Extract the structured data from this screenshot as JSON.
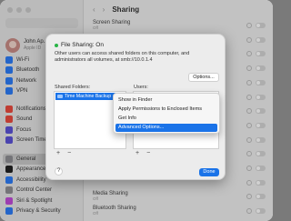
{
  "window_title": "Sharing",
  "user": {
    "name": "John Ap...",
    "sub": "Apple ID"
  },
  "sidebar": {
    "items": [
      {
        "label": "Wi-Fi",
        "icon": "wifi-icon",
        "color": "#2d7cf6"
      },
      {
        "label": "Bluetooth",
        "icon": "bluetooth-icon",
        "color": "#2d7cf6"
      },
      {
        "label": "Network",
        "icon": "network-icon",
        "color": "#2d7cf6"
      },
      {
        "label": "VPN",
        "icon": "vpn-icon",
        "color": "#2d7cf6"
      },
      {
        "label": "Notifications",
        "icon": "bell-icon",
        "color": "#ea4b3f"
      },
      {
        "label": "Sound",
        "icon": "sound-icon",
        "color": "#ea4b3f"
      },
      {
        "label": "Focus",
        "icon": "moon-icon",
        "color": "#5b52d6"
      },
      {
        "label": "Screen Time",
        "icon": "hourglass-icon",
        "color": "#5b52d6"
      },
      {
        "label": "General",
        "icon": "gear-icon",
        "color": "#8e8e93"
      },
      {
        "label": "Appearance",
        "icon": "appearance-icon",
        "color": "#222222"
      },
      {
        "label": "Accessibility",
        "icon": "accessibility-icon",
        "color": "#2d7cf6"
      },
      {
        "label": "Control Center",
        "icon": "control-center-icon",
        "color": "#8e8e93"
      },
      {
        "label": "Siri & Spotlight",
        "icon": "siri-icon",
        "color": "#c04bd8"
      },
      {
        "label": "Privacy & Security",
        "icon": "hand-icon",
        "color": "#2d7cf6"
      }
    ]
  },
  "content_rows": [
    {
      "title": "Screen Sharing",
      "status": "Off"
    },
    {
      "title": "",
      "status": ""
    },
    {
      "title": "",
      "status": ""
    },
    {
      "title": "",
      "status": ""
    },
    {
      "title": "",
      "status": ""
    },
    {
      "title": "",
      "status": ""
    },
    {
      "title": "",
      "status": ""
    },
    {
      "title": "",
      "status": ""
    },
    {
      "title": "",
      "status": ""
    },
    {
      "title": "",
      "status": ""
    },
    {
      "title": "",
      "status": ""
    },
    {
      "title": "",
      "status": ""
    },
    {
      "title": "Media Sharing",
      "status": "Off"
    },
    {
      "title": "Bluetooth Sharing",
      "status": "Off"
    }
  ],
  "sheet": {
    "status_title": "File Sharing: On",
    "description": "Other users can access shared folders on this computer, and administrators all volumes, at smb://10.0.1.4",
    "options_label": "Options...",
    "shared_folders_label": "Shared Folders:",
    "users_label": "Users:",
    "folders": [
      "Time Machine Backup"
    ],
    "plus": "+",
    "minus": "−",
    "help": "?",
    "done_label": "Done"
  },
  "context_menu": {
    "items": [
      {
        "label": "Show in Finder",
        "highlighted": false
      },
      {
        "label": "Apply Permissions to Enclosed Items",
        "highlighted": false
      },
      {
        "label": "Get Info",
        "highlighted": false
      },
      {
        "label": "Advanced Options...",
        "highlighted": true
      }
    ]
  },
  "colors": {
    "accent": "#1a73e8",
    "status_on": "#28b446"
  }
}
